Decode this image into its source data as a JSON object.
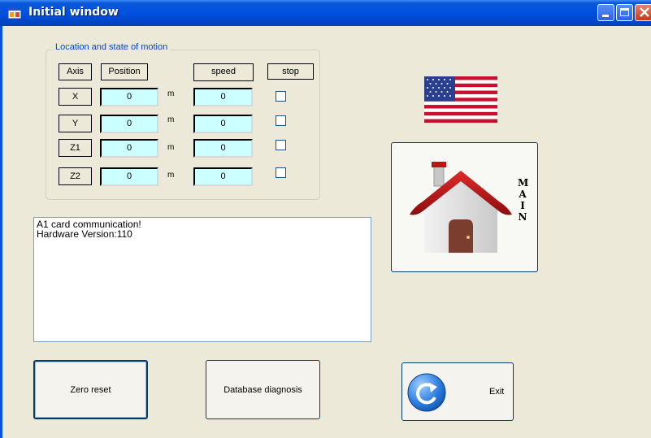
{
  "window": {
    "title": "Initial window"
  },
  "motion_group": {
    "title": "Location and state of motion",
    "headers": {
      "axis": "Axis",
      "position": "Position",
      "speed": "speed",
      "stop": "stop"
    },
    "unit": "m",
    "rows": [
      {
        "axis": "X",
        "position": "0",
        "speed": "0",
        "stop": false
      },
      {
        "axis": "Y",
        "position": "0",
        "speed": "0",
        "stop": false
      },
      {
        "axis": "Z1",
        "position": "0",
        "speed": "0",
        "stop": false
      },
      {
        "axis": "Z2",
        "position": "0",
        "speed": "0",
        "stop": false
      }
    ]
  },
  "log": {
    "lines": [
      "A1 card communication!",
      "Hardware Version:110"
    ]
  },
  "main_button": {
    "letters": [
      "M",
      "A",
      "I",
      "N"
    ]
  },
  "buttons": {
    "zero_reset": "Zero reset",
    "database_diagnosis": "Database diagnosis",
    "exit": "Exit"
  },
  "icons": {
    "window": "app-window-icon",
    "flag": "us-flag-icon",
    "home": "house-icon",
    "exit": "refresh-arrow-icon"
  }
}
